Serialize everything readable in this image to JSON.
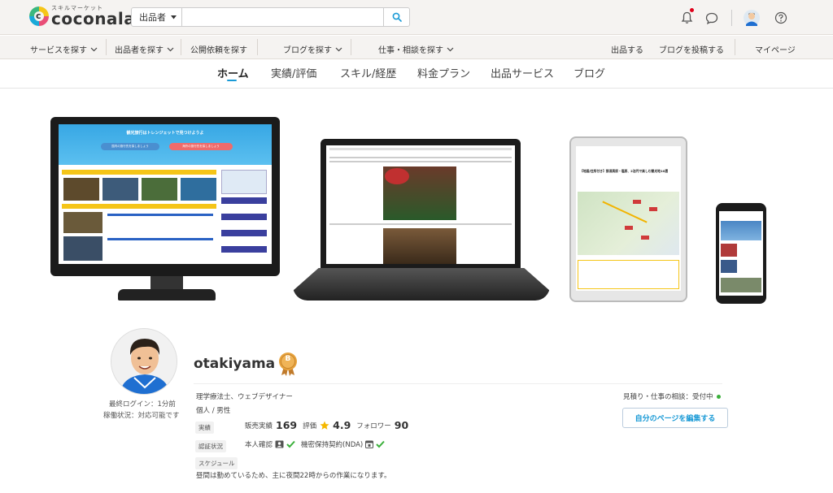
{
  "header": {
    "logo_sub": "スキルマーケット",
    "logo_main": "coconala",
    "logo_mark": "c",
    "search_category": "出品者",
    "search_placeholder": ""
  },
  "navbar": {
    "left": [
      {
        "label": "サービスを探す",
        "chevron": true
      },
      {
        "label": "出品者を探す",
        "chevron": true
      },
      {
        "label": "公開依頼を探す",
        "chevron": false
      },
      {
        "label": "ブログを探す",
        "chevron": true
      },
      {
        "label": "仕事・相談を探す",
        "chevron": true
      }
    ],
    "right": [
      "出品する",
      "ブログを投稿する",
      "マイページ"
    ]
  },
  "tabs": [
    "ホーム",
    "実績/評価",
    "スキル/経歴",
    "料金プラン",
    "出品サービス",
    "ブログ"
  ],
  "hero": {
    "desktop_title": "観光旅行はトレンジェットで見つけようよ",
    "desktop_btn1": "国内の旅行先を探しましょう",
    "desktop_btn2": "海外の旅行先を探しましょう",
    "tablet_title": "【地図/住所付き】那須高原・塩原、2泊円で楽しむ観光地10選"
  },
  "profile": {
    "last_login": "最終ログイン：1分前",
    "status": "稼働状況：対応可能です",
    "username": "otakiyama",
    "rank_badge": "B",
    "occupation": "理学療法士、ウェブデザイナー",
    "type_gender": "個人 / 男性",
    "achievements_tag": "実績",
    "sales_label": "販売実績",
    "sales_count": "169",
    "rating_label": "評価",
    "rating_value": "4.9",
    "followers_label": "フォロワー",
    "followers_count": "90",
    "verification_tag": "認証状況",
    "identity_label": "本人確認",
    "nda_label": "機密保持契約(NDA)",
    "schedule_tag": "スケジュール",
    "schedule_text": "昼間は勤めているため、主に夜間22時からの作業になります。",
    "consult_status": "見積り・仕事の相談：受付中",
    "edit_button": "自分のページを編集する"
  },
  "colors": {
    "accent": "#1a9ad6",
    "green": "#3bb03b",
    "star": "#f5b800",
    "badge": "#e8a33d"
  }
}
